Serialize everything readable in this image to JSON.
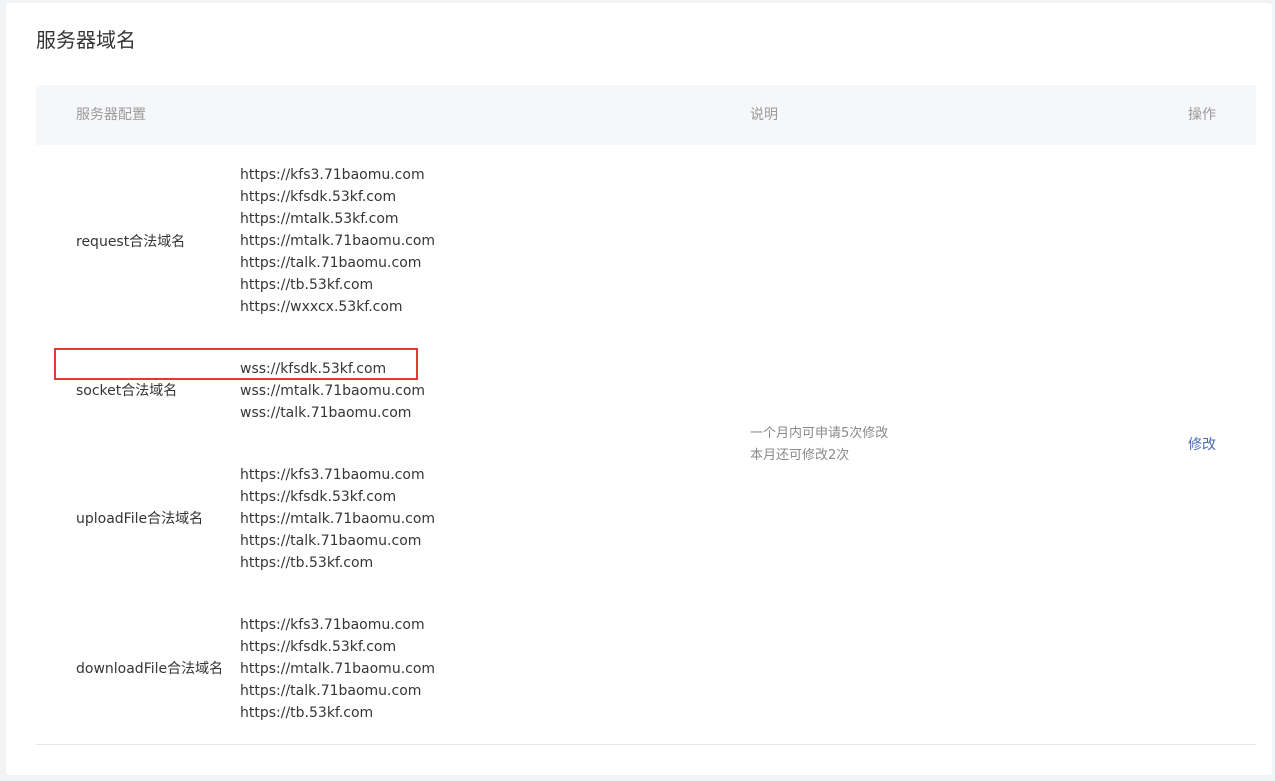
{
  "page": {
    "title": "服务器域名"
  },
  "table": {
    "headers": {
      "config": "服务器配置",
      "description": "说明",
      "action": "操作"
    },
    "rows": [
      {
        "label": "request合法域名",
        "domains": [
          "https://kfs3.71baomu.com",
          "https://kfsdk.53kf.com",
          "https://mtalk.53kf.com",
          "https://mtalk.71baomu.com",
          "https://talk.71baomu.com",
          "https://tb.53kf.com",
          "https://wxxcx.53kf.com"
        ]
      },
      {
        "label": "socket合法域名",
        "domains": [
          "wss://kfsdk.53kf.com",
          "wss://mtalk.71baomu.com",
          "wss://talk.71baomu.com"
        ]
      },
      {
        "label": "uploadFile合法域名",
        "domains": [
          "https://kfs3.71baomu.com",
          "https://kfsdk.53kf.com",
          "https://mtalk.71baomu.com",
          "https://talk.71baomu.com",
          "https://tb.53kf.com"
        ]
      },
      {
        "label": "downloadFile合法域名",
        "domains": [
          "https://kfs3.71baomu.com",
          "https://kfsdk.53kf.com",
          "https://mtalk.71baomu.com",
          "https://talk.71baomu.com",
          "https://tb.53kf.com"
        ]
      }
    ],
    "description": {
      "line1": "一个月内可申请5次修改",
      "line2": "本月还可修改2次"
    },
    "action_label": "修改"
  },
  "colors": {
    "highlight_border": "#e53935",
    "link": "#4a6bb3",
    "header_bg": "#f6f7f9"
  }
}
